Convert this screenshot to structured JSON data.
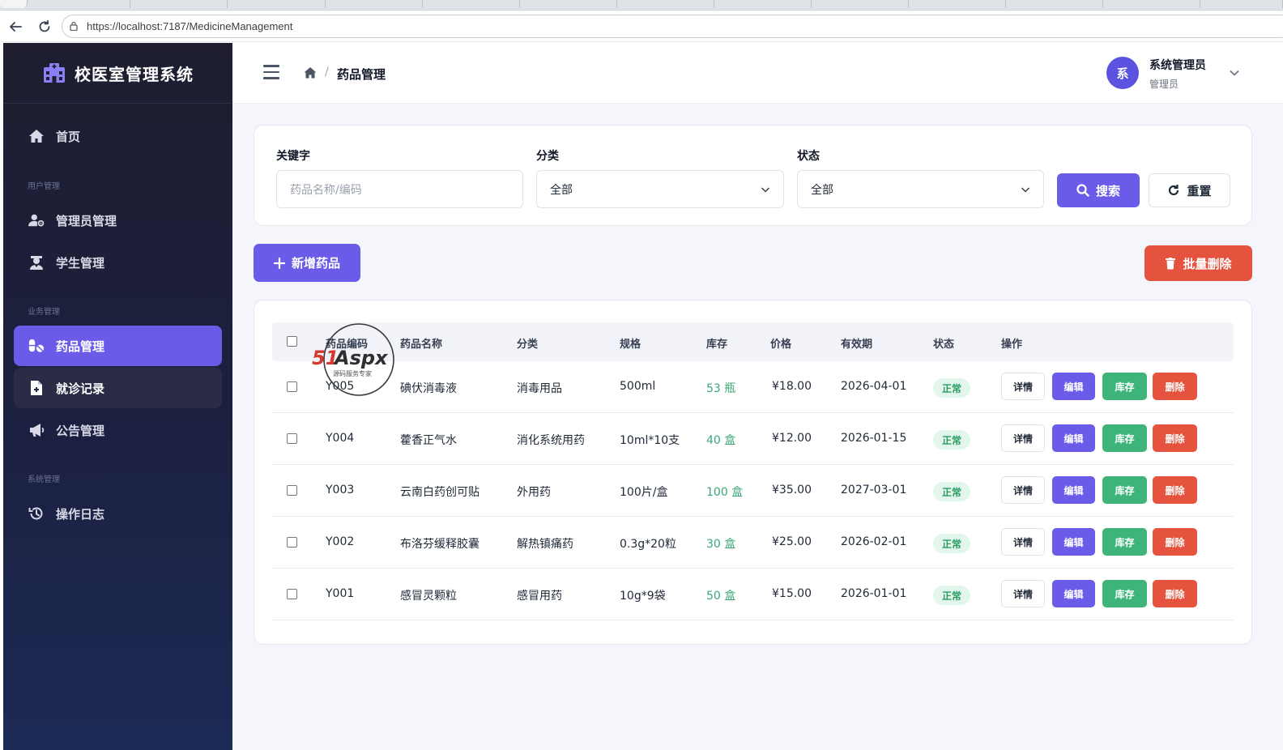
{
  "browser": {
    "url": "https://localhost:7187/MedicineManagement"
  },
  "sidebar": {
    "app_title": "校医室管理系统",
    "home_label": "首页",
    "sections": {
      "user_mgmt": "用户管理",
      "business_mgmt": "业务管理",
      "system_mgmt": "系统管理"
    },
    "items": {
      "admin_mgmt": "管理员管理",
      "student_mgmt": "学生管理",
      "medicine_mgmt": "药品管理",
      "visit_records": "就诊记录",
      "announcement_mgmt": "公告管理",
      "operation_log": "操作日志"
    }
  },
  "header": {
    "breadcrumb_current": "药品管理",
    "breadcrumb_sep": "/",
    "user_name": "系统管理员",
    "user_role": "管理员",
    "avatar_initial": "系"
  },
  "filters": {
    "keyword_label": "关键字",
    "keyword_placeholder": "药品名称/编码",
    "category_label": "分类",
    "category_value": "全部",
    "status_label": "状态",
    "status_value": "全部",
    "search_button": "搜索",
    "reset_button": "重置"
  },
  "toolbar": {
    "add_button": "新增药品",
    "batch_delete_button": "批量删除"
  },
  "table": {
    "headers": {
      "code": "药品编码",
      "name": "药品名称",
      "category": "分类",
      "spec": "规格",
      "stock": "库存",
      "price": "价格",
      "expiry": "有效期",
      "status": "状态",
      "actions": "操作"
    },
    "action_labels": {
      "detail": "详情",
      "edit": "编辑",
      "stock": "库存",
      "delete": "删除"
    },
    "rows": [
      {
        "code": "Y005",
        "name": "碘伏消毒液",
        "category": "消毒用品",
        "spec": "500ml",
        "stock": "53 瓶",
        "price": "¥18.00",
        "expiry": "2026-04-01",
        "status": "正常"
      },
      {
        "code": "Y004",
        "name": "藿香正气水",
        "category": "消化系统用药",
        "spec": "10ml*10支",
        "stock": "40 盒",
        "price": "¥12.00",
        "expiry": "2026-01-15",
        "status": "正常"
      },
      {
        "code": "Y003",
        "name": "云南白药创可贴",
        "category": "外用药",
        "spec": "100片/盒",
        "stock": "100 盒",
        "price": "¥35.00",
        "expiry": "2027-03-01",
        "status": "正常"
      },
      {
        "code": "Y002",
        "name": "布洛芬缓释胶囊",
        "category": "解热镇痛药",
        "spec": "0.3g*20粒",
        "stock": "30 盒",
        "price": "¥25.00",
        "expiry": "2026-02-01",
        "status": "正常"
      },
      {
        "code": "Y001",
        "name": "感冒灵颗粒",
        "category": "感冒用药",
        "spec": "10g*9袋",
        "stock": "50 盒",
        "price": "¥15.00",
        "expiry": "2026-01-01",
        "status": "正常"
      }
    ]
  },
  "watermark": {
    "brand": "51Aspx",
    "tagline": "源码服务专家"
  },
  "colors": {
    "accent": "#6a5ce8",
    "danger": "#e5533f",
    "success": "#3db47a",
    "sidebar_bg": "#1e1e30"
  }
}
